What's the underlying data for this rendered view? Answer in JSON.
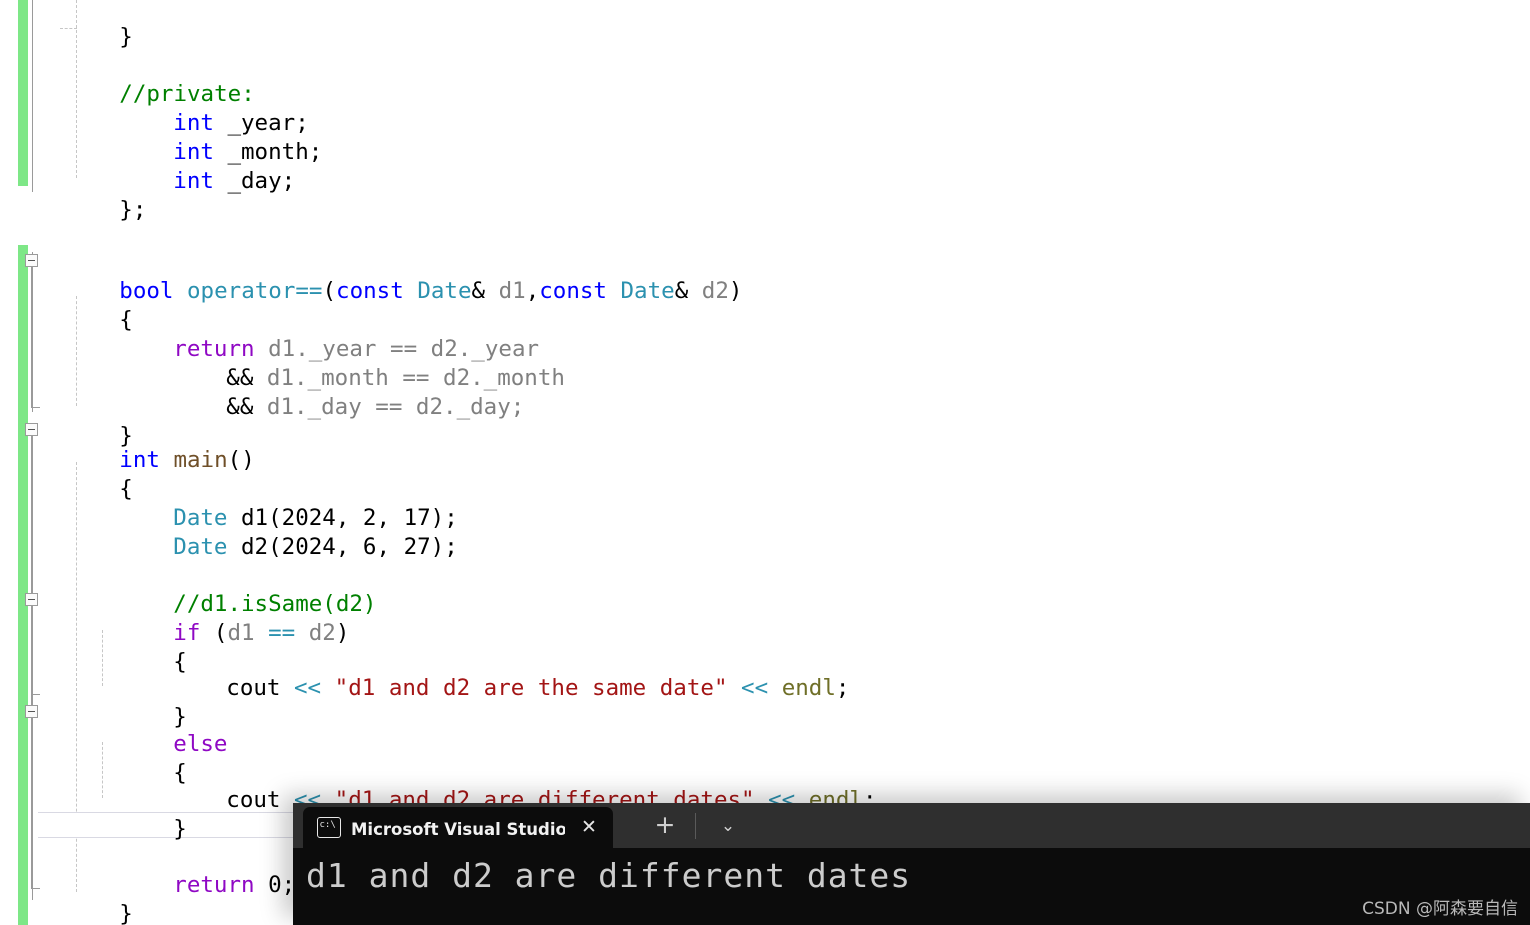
{
  "editor": {
    "language": "cpp",
    "colors": {
      "keyword": "#0000FF",
      "control": "#8F08C4",
      "type": "#2B91AF",
      "comment": "#008000",
      "string": "#A31515",
      "identifier": "#808080",
      "operator": "#2B91AF",
      "plain": "#000000",
      "background": "#FFFFFF",
      "change_bar": "#7EE787"
    },
    "lines": [
      {
        "indent": 2,
        "text": "}"
      },
      {
        "indent": 0,
        "text": ""
      },
      {
        "indent": 0,
        "text": "//private:"
      },
      {
        "indent": 1,
        "text": "int _year;"
      },
      {
        "indent": 1,
        "text": "int _month;"
      },
      {
        "indent": 1,
        "text": "int _day;"
      },
      {
        "indent": 0,
        "text": "};"
      },
      {
        "indent": 0,
        "text": ""
      },
      {
        "indent": 0,
        "text": ""
      },
      {
        "indent": 0,
        "text": "bool operator==(const Date& d1,const Date& d2)"
      },
      {
        "indent": 0,
        "text": "{"
      },
      {
        "indent": 1,
        "text": "return d1._year == d2._year"
      },
      {
        "indent": 2,
        "text": "&& d1._month == d2._month"
      },
      {
        "indent": 2,
        "text": "&& d1._day == d2._day;"
      },
      {
        "indent": 0,
        "text": "}"
      },
      {
        "indent": 0,
        "text": "int main()"
      },
      {
        "indent": 0,
        "text": "{"
      },
      {
        "indent": 1,
        "text": "Date d1(2024, 2, 17);"
      },
      {
        "indent": 1,
        "text": "Date d2(2024, 6, 27);"
      },
      {
        "indent": 0,
        "text": ""
      },
      {
        "indent": 1,
        "text": "//d1.isSame(d2)"
      },
      {
        "indent": 1,
        "text": "if (d1 == d2)"
      },
      {
        "indent": 1,
        "text": "{"
      },
      {
        "indent": 2,
        "text": "cout << \"d1 and d2 are the same date\" << endl;"
      },
      {
        "indent": 1,
        "text": "}"
      },
      {
        "indent": 1,
        "text": "else"
      },
      {
        "indent": 1,
        "text": "{"
      },
      {
        "indent": 2,
        "text": "cout << \"d1 and d2 are different dates\" << endl;"
      },
      {
        "indent": 1,
        "text": "}"
      },
      {
        "indent": 0,
        "text": ""
      },
      {
        "indent": 1,
        "text": "return 0;"
      },
      {
        "indent": 0,
        "text": "}"
      }
    ],
    "tokens": {
      "brace_close": "}",
      "brace_open": "{",
      "comment_private": "//private:",
      "kw_int": "int",
      "kw_bool": "bool",
      "kw_const": "const",
      "ctl_return": "return",
      "ctl_if": "if",
      "ctl_else": "else",
      "type_Date": "Date",
      "fn_main": "main",
      "fn_operator": "operator==",
      "id_year": "_year;",
      "id_month": "_month;",
      "id_day": "_day;",
      "semi_brace": "};",
      "str_same": "\"d1 and d2 are the same date\"",
      "str_diff": "\"d1 and d2 are different dates\"",
      "io_cout": "cout",
      "io_endl": "endl",
      "op_shift": "<<",
      "op_eq": "==",
      "op_and": "&&",
      "comment_issame": "//d1.isSame(d2)",
      "ctor_d1": "d1(2024, 2, 17);",
      "ctor_d2": "d2(2024, 6, 27);",
      "ret_zero": "0;"
    }
  },
  "terminal": {
    "tab_title": "Microsoft Visual Studio 调试控",
    "tab_icon": "console-icon",
    "close_label": "✕",
    "new_tab_label": "+",
    "dropdown_label": "⌄",
    "output": "d1 and d2 are different dates",
    "background": "#0C0C0C",
    "tabbar_background": "#2F2F2F"
  },
  "watermark": {
    "text": "CSDN @阿森要自信"
  }
}
